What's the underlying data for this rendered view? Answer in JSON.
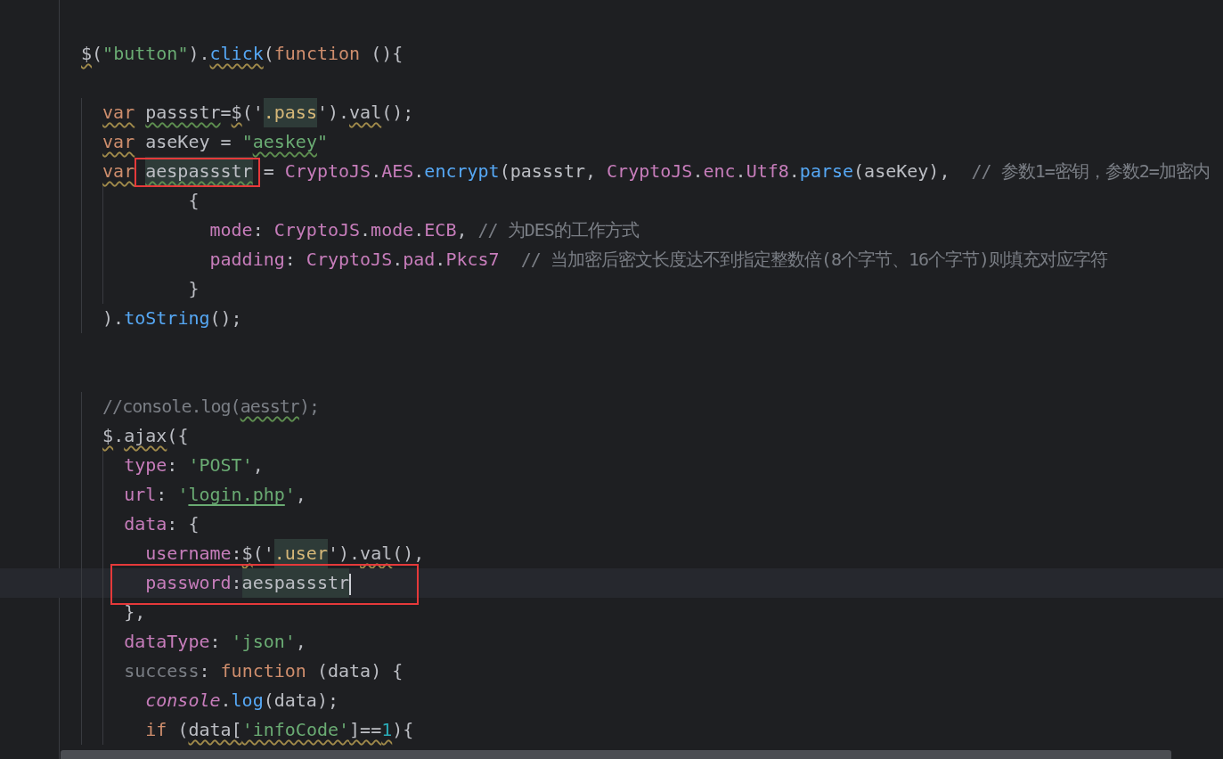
{
  "editor": {
    "lines": [
      {
        "kind": "code",
        "tokens": [
          {
            "text": "$",
            "kind": "plain",
            "warning": true
          },
          {
            "text": "(",
            "kind": "plain"
          },
          {
            "text": "\"button\"",
            "kind": "string"
          },
          {
            "text": ").",
            "kind": "plain"
          },
          {
            "text": "click",
            "kind": "call",
            "warning": true
          },
          {
            "text": "(",
            "kind": "plain"
          },
          {
            "text": "function",
            "kind": "keyword"
          },
          {
            "text": " (){",
            "kind": "plain"
          }
        ]
      },
      {
        "kind": "blank"
      },
      {
        "kind": "code",
        "tokens": [
          {
            "text": "  var",
            "kind": "keyword",
            "warning": true
          },
          {
            "text": " passstr",
            "kind": "plain",
            "typo": true
          },
          {
            "text": "=",
            "kind": "plain"
          },
          {
            "text": "$",
            "kind": "plain",
            "warning": true
          },
          {
            "text": "('",
            "kind": "plain"
          },
          {
            "text": ".pass",
            "kind": "selector",
            "highlighted": true
          },
          {
            "text": "').",
            "kind": "plain"
          },
          {
            "text": "val",
            "kind": "plain",
            "warning": true
          },
          {
            "text": "();",
            "kind": "plain"
          }
        ]
      },
      {
        "kind": "code",
        "tokens": [
          {
            "text": "  var",
            "kind": "keyword",
            "warning": true
          },
          {
            "text": " aseKey = ",
            "kind": "plain"
          },
          {
            "text": "\"",
            "kind": "string"
          },
          {
            "text": "aeskey",
            "kind": "string",
            "typo": true
          },
          {
            "text": "\"",
            "kind": "string"
          }
        ]
      },
      {
        "kind": "code",
        "tokens": [
          {
            "text": "  var",
            "kind": "keyword",
            "warning": true
          },
          {
            "text": " aespassstr",
            "kind": "plain",
            "typo": true,
            "highlighted": true,
            "boxed": true
          },
          {
            "text": " = ",
            "kind": "plain"
          },
          {
            "text": "CryptoJS",
            "kind": "prop"
          },
          {
            "text": ".",
            "kind": "plain"
          },
          {
            "text": "AES",
            "kind": "prop"
          },
          {
            "text": ".",
            "kind": "plain"
          },
          {
            "text": "encrypt",
            "kind": "call"
          },
          {
            "text": "(passstr, ",
            "kind": "plain"
          },
          {
            "text": "CryptoJS",
            "kind": "prop"
          },
          {
            "text": ".",
            "kind": "plain"
          },
          {
            "text": "enc",
            "kind": "prop"
          },
          {
            "text": ".",
            "kind": "plain"
          },
          {
            "text": "Utf8",
            "kind": "prop"
          },
          {
            "text": ".",
            "kind": "plain"
          },
          {
            "text": "parse",
            "kind": "call"
          },
          {
            "text": "(aseKey),",
            "kind": "plain"
          },
          {
            "text": "  // 参数1=密钥，参数2=加密内",
            "kind": "comment"
          }
        ]
      },
      {
        "kind": "code",
        "tokens": [
          {
            "text": "          {",
            "kind": "plain"
          }
        ]
      },
      {
        "kind": "code",
        "tokens": [
          {
            "text": "            mode",
            "kind": "prop"
          },
          {
            "text": ": ",
            "kind": "plain"
          },
          {
            "text": "CryptoJS",
            "kind": "prop"
          },
          {
            "text": ".",
            "kind": "plain"
          },
          {
            "text": "mode",
            "kind": "prop"
          },
          {
            "text": ".",
            "kind": "plain"
          },
          {
            "text": "ECB",
            "kind": "prop"
          },
          {
            "text": ",",
            "kind": "plain"
          },
          {
            "text": " // 为DES的工作方式",
            "kind": "comment"
          }
        ]
      },
      {
        "kind": "code",
        "tokens": [
          {
            "text": "            padding",
            "kind": "prop"
          },
          {
            "text": ": ",
            "kind": "plain"
          },
          {
            "text": "CryptoJS",
            "kind": "prop"
          },
          {
            "text": ".",
            "kind": "plain"
          },
          {
            "text": "pad",
            "kind": "prop"
          },
          {
            "text": ".",
            "kind": "plain"
          },
          {
            "text": "Pkcs7",
            "kind": "prop"
          },
          {
            "text": "  // 当加密后密文长度达不到指定整数倍(8个字节、16个字节)则填充对应字符",
            "kind": "comment"
          }
        ]
      },
      {
        "kind": "code",
        "tokens": [
          {
            "text": "          }",
            "kind": "plain"
          }
        ]
      },
      {
        "kind": "code",
        "tokens": [
          {
            "text": "  ).",
            "kind": "plain"
          },
          {
            "text": "toString",
            "kind": "call"
          },
          {
            "text": "();",
            "kind": "plain"
          }
        ]
      },
      {
        "kind": "blank"
      },
      {
        "kind": "blank"
      },
      {
        "kind": "code",
        "tokens": [
          {
            "text": "  //console.log(",
            "kind": "comment"
          },
          {
            "text": "aesstr",
            "kind": "comment",
            "typo": true
          },
          {
            "text": ");",
            "kind": "comment"
          }
        ]
      },
      {
        "kind": "code",
        "tokens": [
          {
            "text": "  $",
            "kind": "plain",
            "warning": true
          },
          {
            "text": ".",
            "kind": "plain"
          },
          {
            "text": "ajax",
            "kind": "plain",
            "warning": true
          },
          {
            "text": "({",
            "kind": "plain"
          }
        ]
      },
      {
        "kind": "code",
        "tokens": [
          {
            "text": "    type",
            "kind": "prop"
          },
          {
            "text": ": ",
            "kind": "plain"
          },
          {
            "text": "'POST'",
            "kind": "string"
          },
          {
            "text": ",",
            "kind": "plain"
          }
        ]
      },
      {
        "kind": "code",
        "tokens": [
          {
            "text": "    url",
            "kind": "prop"
          },
          {
            "text": ": ",
            "kind": "plain"
          },
          {
            "text": "'",
            "kind": "string"
          },
          {
            "text": "login.php",
            "kind": "string",
            "link": true
          },
          {
            "text": "'",
            "kind": "string"
          },
          {
            "text": ",",
            "kind": "plain"
          }
        ]
      },
      {
        "kind": "code",
        "tokens": [
          {
            "text": "    data",
            "kind": "prop"
          },
          {
            "text": ": {",
            "kind": "plain"
          }
        ]
      },
      {
        "kind": "code",
        "tokens": [
          {
            "text": "      username",
            "kind": "prop"
          },
          {
            "text": ":",
            "kind": "plain"
          },
          {
            "text": "$",
            "kind": "plain",
            "warning": true
          },
          {
            "text": "('",
            "kind": "plain"
          },
          {
            "text": ".user",
            "kind": "selector",
            "highlighted": true
          },
          {
            "text": "').",
            "kind": "plain"
          },
          {
            "text": "val",
            "kind": "plain",
            "warning": true
          },
          {
            "text": "(),",
            "kind": "plain"
          }
        ]
      },
      {
        "kind": "code",
        "current": true,
        "boxed": true,
        "caret": true,
        "tokens": [
          {
            "text": "      password",
            "kind": "prop"
          },
          {
            "text": ":",
            "kind": "plain"
          },
          {
            "text": "aespassstr",
            "kind": "plain",
            "highlighted": true
          }
        ]
      },
      {
        "kind": "code",
        "tokens": [
          {
            "text": "    },",
            "kind": "plain"
          }
        ]
      },
      {
        "kind": "code",
        "tokens": [
          {
            "text": "    dataType",
            "kind": "prop"
          },
          {
            "text": ": ",
            "kind": "plain"
          },
          {
            "text": "'json'",
            "kind": "string"
          },
          {
            "text": ",",
            "kind": "plain"
          }
        ]
      },
      {
        "kind": "code",
        "tokens": [
          {
            "text": "    success",
            "kind": "unused"
          },
          {
            "text": ": ",
            "kind": "plain"
          },
          {
            "text": "function",
            "kind": "keyword"
          },
          {
            "text": " (data) {",
            "kind": "plain"
          }
        ]
      },
      {
        "kind": "code",
        "tokens": [
          {
            "text": "      console",
            "kind": "italic-prop"
          },
          {
            "text": ".",
            "kind": "plain"
          },
          {
            "text": "log",
            "kind": "call"
          },
          {
            "text": "(data);",
            "kind": "plain"
          }
        ]
      },
      {
        "kind": "code",
        "tokens": [
          {
            "text": "      if",
            "kind": "keyword"
          },
          {
            "text": " (",
            "kind": "plain"
          },
          {
            "text": "data[",
            "kind": "plain",
            "warning": true
          },
          {
            "text": "'infoCode'",
            "kind": "string",
            "warning": true
          },
          {
            "text": "]==",
            "kind": "plain",
            "warning": true
          },
          {
            "text": "1",
            "kind": "number",
            "warning": true
          },
          {
            "text": "){",
            "kind": "plain"
          }
        ]
      }
    ]
  }
}
